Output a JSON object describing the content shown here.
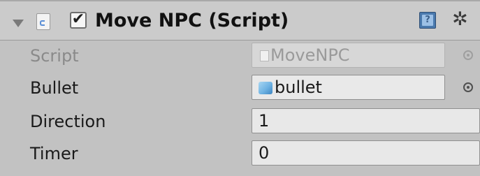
{
  "component": {
    "title": "Move NPC (Script)",
    "enabled_mark": "✔",
    "gear_glyph": "✲",
    "help_glyph": "?",
    "icons": {
      "fold": "fold-arrow-icon",
      "script": "script-file-icon",
      "help": "book-help-icon",
      "settings": "gear-icon"
    }
  },
  "fields": [
    {
      "label": "Script",
      "value": "MoveNPC",
      "type": "object-readonly"
    },
    {
      "label": "Bullet",
      "value": "bullet",
      "type": "object-prefab"
    },
    {
      "label": "Direction",
      "value": "1",
      "type": "number"
    },
    {
      "label": "Timer",
      "value": "0",
      "type": "number"
    }
  ],
  "colors": {
    "panel_bg": "#c2c2c2",
    "prefab_icon": "#6fb3e3",
    "help_icon": "#4a79ad"
  }
}
